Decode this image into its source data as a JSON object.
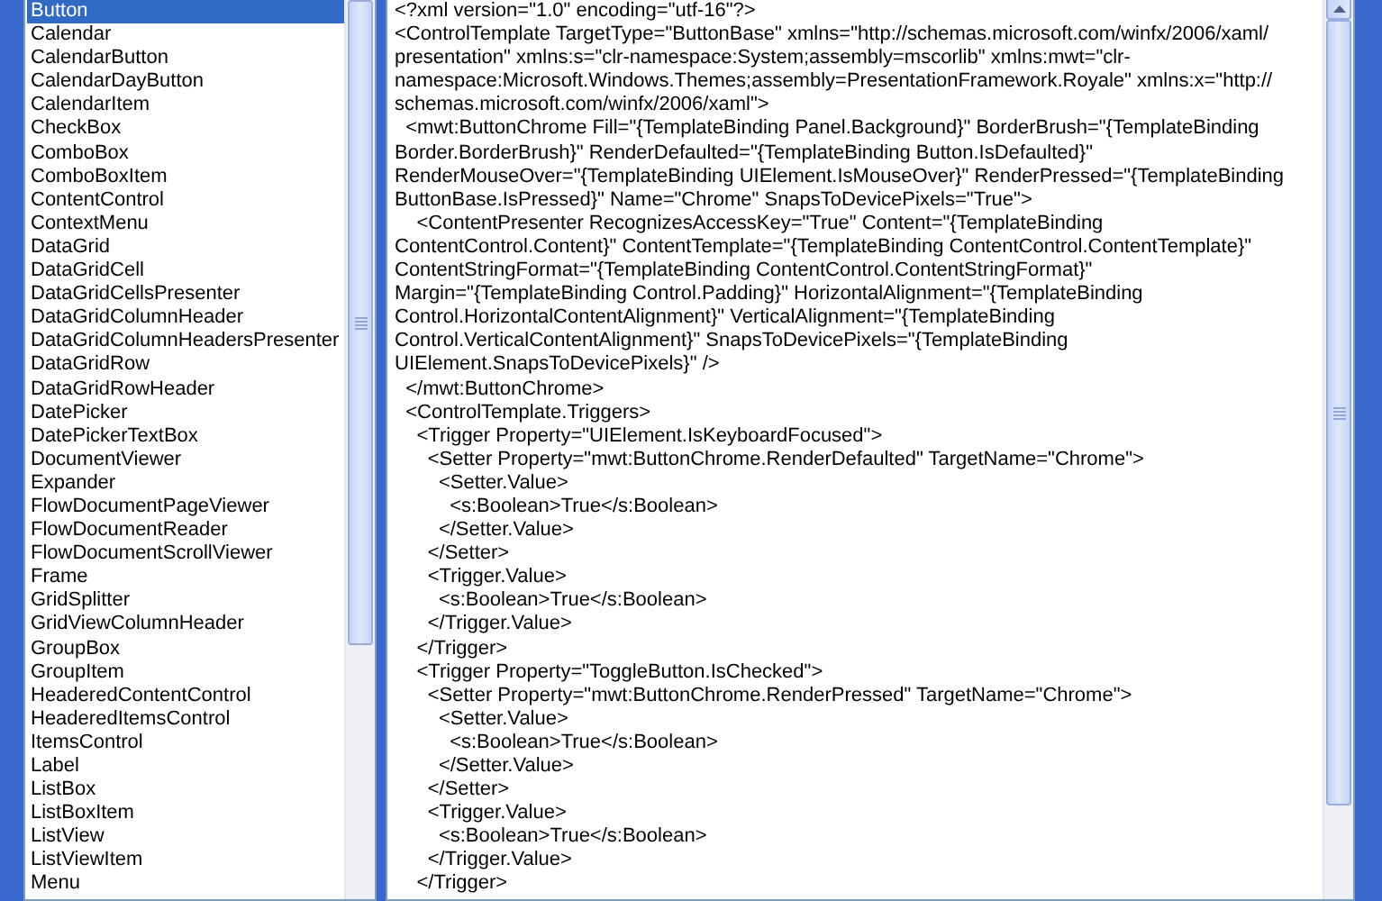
{
  "template_list": {
    "items": [
      {
        "label": "Button",
        "selected": true
      },
      {
        "label": "Calendar",
        "selected": false
      },
      {
        "label": "CalendarButton",
        "selected": false
      },
      {
        "label": "CalendarDayButton",
        "selected": false
      },
      {
        "label": "CalendarItem",
        "selected": false
      },
      {
        "label": "CheckBox",
        "selected": false
      },
      {
        "label": "ComboBox",
        "selected": false
      },
      {
        "label": "ComboBoxItem",
        "selected": false
      },
      {
        "label": "ContentControl",
        "selected": false
      },
      {
        "label": "ContextMenu",
        "selected": false
      },
      {
        "label": "DataGrid",
        "selected": false
      },
      {
        "label": "DataGridCell",
        "selected": false
      },
      {
        "label": "DataGridCellsPresenter",
        "selected": false
      },
      {
        "label": "DataGridColumnHeader",
        "selected": false
      },
      {
        "label": "DataGridColumnHeadersPresenter",
        "selected": false
      },
      {
        "label": "DataGridRow",
        "selected": false
      },
      {
        "label": "DataGridRowHeader",
        "selected": false
      },
      {
        "label": "DatePicker",
        "selected": false
      },
      {
        "label": "DatePickerTextBox",
        "selected": false
      },
      {
        "label": "DocumentViewer",
        "selected": false
      },
      {
        "label": "Expander",
        "selected": false
      },
      {
        "label": "FlowDocumentPageViewer",
        "selected": false
      },
      {
        "label": "FlowDocumentReader",
        "selected": false
      },
      {
        "label": "FlowDocumentScrollViewer",
        "selected": false
      },
      {
        "label": "Frame",
        "selected": false
      },
      {
        "label": "GridSplitter",
        "selected": false
      },
      {
        "label": "GridViewColumnHeader",
        "selected": false
      },
      {
        "label": "GroupBox",
        "selected": false
      },
      {
        "label": "GroupItem",
        "selected": false
      },
      {
        "label": "HeaderedContentControl",
        "selected": false
      },
      {
        "label": "HeaderedItemsControl",
        "selected": false
      },
      {
        "label": "ItemsControl",
        "selected": false
      },
      {
        "label": "Label",
        "selected": false
      },
      {
        "label": "ListBox",
        "selected": false
      },
      {
        "label": "ListBoxItem",
        "selected": false
      },
      {
        "label": "ListView",
        "selected": false
      },
      {
        "label": "ListViewItem",
        "selected": false
      },
      {
        "label": "Menu",
        "selected": false
      }
    ]
  },
  "xaml_view": {
    "lines": [
      "<?xml version=\"1.0\" encoding=\"utf-16\"?>",
      "<ControlTemplate TargetType=\"ButtonBase\" xmlns=\"http://schemas.microsoft.com/winfx/2006/xaml/",
      "presentation\" xmlns:s=\"clr-namespace:System;assembly=mscorlib\" xmlns:mwt=\"clr-",
      "namespace:Microsoft.Windows.Themes;assembly=PresentationFramework.Royale\" xmlns:x=\"http://",
      "schemas.microsoft.com/winfx/2006/xaml\">",
      "  <mwt:ButtonChrome Fill=\"{TemplateBinding Panel.Background}\" BorderBrush=\"{TemplateBinding",
      "Border.BorderBrush}\" RenderDefaulted=\"{TemplateBinding Button.IsDefaulted}\"",
      "RenderMouseOver=\"{TemplateBinding UIElement.IsMouseOver}\" RenderPressed=\"{TemplateBinding",
      "ButtonBase.IsPressed}\" Name=\"Chrome\" SnapsToDevicePixels=\"True\">",
      "    <ContentPresenter RecognizesAccessKey=\"True\" Content=\"{TemplateBinding",
      "ContentControl.Content}\" ContentTemplate=\"{TemplateBinding ContentControl.ContentTemplate}\"",
      "ContentStringFormat=\"{TemplateBinding ContentControl.ContentStringFormat}\"",
      "Margin=\"{TemplateBinding Control.Padding}\" HorizontalAlignment=\"{TemplateBinding",
      "Control.HorizontalContentAlignment}\" VerticalAlignment=\"{TemplateBinding",
      "Control.VerticalContentAlignment}\" SnapsToDevicePixels=\"{TemplateBinding",
      "UIElement.SnapsToDevicePixels}\" />",
      "  </mwt:ButtonChrome>",
      "  <ControlTemplate.Triggers>",
      "    <Trigger Property=\"UIElement.IsKeyboardFocused\">",
      "      <Setter Property=\"mwt:ButtonChrome.RenderDefaulted\" TargetName=\"Chrome\">",
      "        <Setter.Value>",
      "          <s:Boolean>True</s:Boolean>",
      "        </Setter.Value>",
      "      </Setter>",
      "      <Trigger.Value>",
      "        <s:Boolean>True</s:Boolean>",
      "      </Trigger.Value>",
      "    </Trigger>",
      "    <Trigger Property=\"ToggleButton.IsChecked\">",
      "      <Setter Property=\"mwt:ButtonChrome.RenderPressed\" TargetName=\"Chrome\">",
      "        <Setter.Value>",
      "          <s:Boolean>True</s:Boolean>",
      "        </Setter.Value>",
      "      </Setter>",
      "      <Trigger.Value>",
      "        <s:Boolean>True</s:Boolean>",
      "      </Trigger.Value>",
      "    </Trigger>"
    ]
  }
}
